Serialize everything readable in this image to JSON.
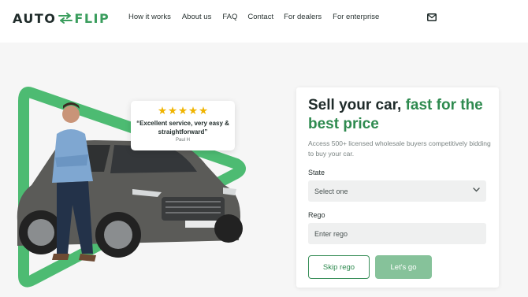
{
  "brand": {
    "logo_left": "AUTO",
    "logo_right": "FLIP"
  },
  "nav": {
    "items": [
      "How it works",
      "About us",
      "FAQ",
      "Contact",
      "For dealers",
      "For enterprise"
    ]
  },
  "header": {
    "mail_icon": "mail-icon"
  },
  "review": {
    "stars": 5,
    "quote": "“Excellent service, very easy & straightforward”",
    "author": "Paul H"
  },
  "form": {
    "title_plain": "Sell your car, ",
    "title_highlight": "fast for the best price",
    "subtitle": "Access 500+ licensed wholesale buyers competitively bidding to buy your car.",
    "state_label": "State",
    "state_value": "Select one",
    "rego_label": "Rego",
    "rego_placeholder": "Enter rego",
    "skip_label": "Skip rego",
    "go_label": "Let's go"
  },
  "colors": {
    "accent": "#2e8a4f",
    "button_disabled": "#86c29a",
    "hero_bg": "#f6f6f6"
  }
}
